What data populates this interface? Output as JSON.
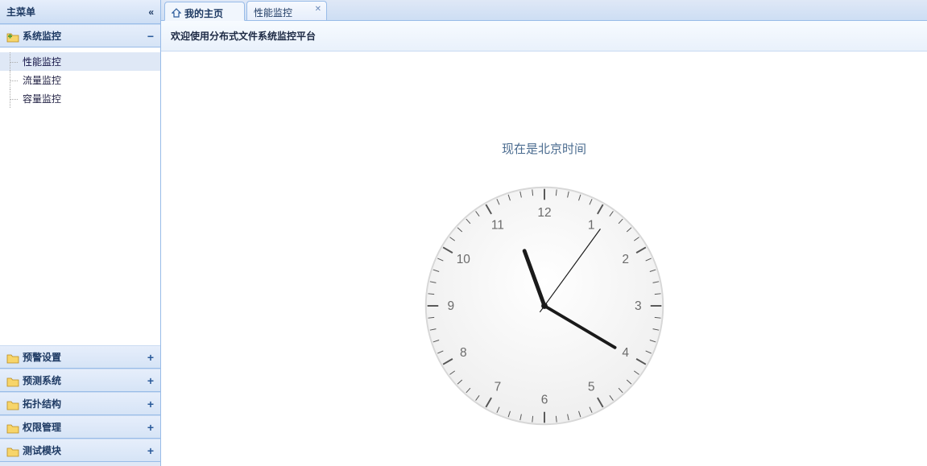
{
  "sidebar": {
    "title": "主菜单",
    "groups": [
      {
        "label": "系统监控",
        "expanded": true,
        "items": [
          {
            "label": "性能监控",
            "selected": true
          },
          {
            "label": "流量监控",
            "selected": false
          },
          {
            "label": "容量监控",
            "selected": false
          }
        ]
      },
      {
        "label": "预警设置",
        "expanded": false
      },
      {
        "label": "预测系统",
        "expanded": false
      },
      {
        "label": "拓扑结构",
        "expanded": false
      },
      {
        "label": "权限管理",
        "expanded": false
      },
      {
        "label": "测试模块",
        "expanded": false
      }
    ]
  },
  "tabs": [
    {
      "label": "我的主页",
      "closable": false,
      "active": true,
      "home": true
    },
    {
      "label": "性能监控",
      "closable": true,
      "active": false,
      "home": false
    }
  ],
  "welcome": "欢迎使用分布式文件系统监控平台",
  "clock_label": "现在是北京时间",
  "clock": {
    "hour": 11,
    "minute": 20,
    "second": 6
  }
}
